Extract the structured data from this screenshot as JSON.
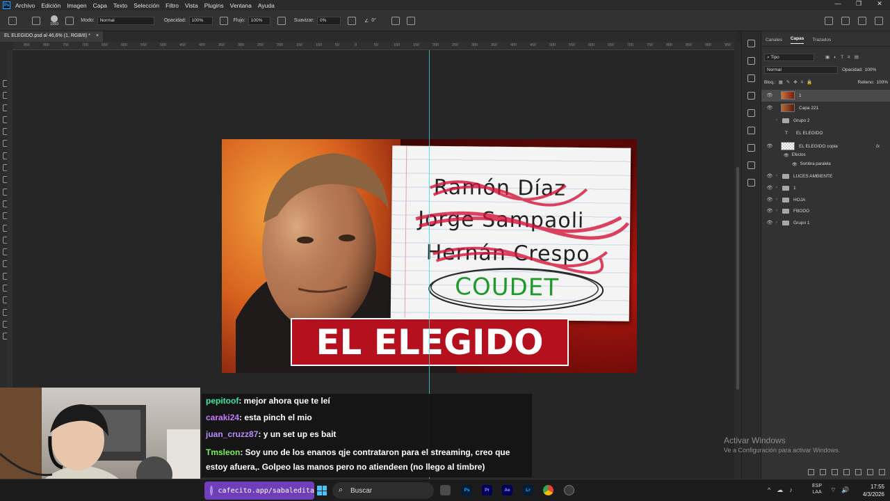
{
  "menubar": {
    "items": [
      "Archivo",
      "Edición",
      "Imagen",
      "Capa",
      "Texto",
      "Selección",
      "Filtro",
      "Vista",
      "Plugins",
      "Ventana",
      "Ayuda"
    ],
    "app_icon": "Ps"
  },
  "options": {
    "brush_size": "1993",
    "mode_label": "Modo:",
    "mode_value": "Normal",
    "opacity_label": "Opacidad:",
    "opacity_value": "100%",
    "flow_label": "Flujo:",
    "flow_value": "100%",
    "smoothing_label": "Suavizar:",
    "smoothing_value": "0%",
    "angle_value": "0°"
  },
  "document": {
    "tab_title": "EL ELEGIDO.psd al 46,6% (1, RGB/8) *"
  },
  "ruler": {
    "ticks": [
      "900",
      "850",
      "800",
      "750",
      "700",
      "650",
      "600",
      "550",
      "500",
      "450",
      "400",
      "350",
      "300",
      "250",
      "200",
      "150",
      "100",
      "50",
      "0",
      "50",
      "100",
      "150",
      "200",
      "250",
      "300",
      "350",
      "400",
      "450",
      "500",
      "550",
      "600",
      "650",
      "700",
      "750",
      "800",
      "850",
      "900",
      "950",
      "1000",
      "1050",
      "1100",
      "1150",
      "1200",
      "1250",
      "1300",
      "1350",
      "1400",
      "1450",
      "1500",
      "1550",
      "1600",
      "1650",
      "1700",
      "1750",
      "1800",
      "1850",
      "1900",
      "1950",
      "2000",
      "2050",
      "2100",
      "2150",
      "2200",
      "2250",
      "2300"
    ]
  },
  "thumbnail": {
    "names": [
      "Ramón Díaz",
      "Jorge Sampaoli",
      "Hernán Crespo"
    ],
    "circled_name": "COUDET",
    "title": "EL ELEGIDO"
  },
  "panel": {
    "tabs": [
      "Canales",
      "Capas",
      "Trazados"
    ],
    "filter_label": "Tipo",
    "blend_mode": "Normal",
    "opacity_label": "Opacidad:",
    "opacity_value": "100%",
    "lock_label": "Bloq.:",
    "fill_label": "Relleno:",
    "fill_value": "100%",
    "layers": [
      {
        "name": "1",
        "kind": "image",
        "visible": true,
        "selected": true
      },
      {
        "name": "Capa 221",
        "kind": "image",
        "visible": true
      },
      {
        "name": "Grupo 2",
        "kind": "group",
        "visible": false
      },
      {
        "name": "EL ELEGIDO",
        "kind": "text",
        "visible": false
      },
      {
        "name": "EL ELEGIDO copia",
        "kind": "image",
        "visible": true,
        "fx": "fx"
      },
      {
        "name": "Efectos",
        "kind": "effects",
        "visible": true
      },
      {
        "name": "Sombra paralela",
        "kind": "effect",
        "visible": true
      },
      {
        "name": "LUCES AMBIENTE",
        "kind": "group",
        "visible": true
      },
      {
        "name": "1",
        "kind": "group",
        "visible": true
      },
      {
        "name": "HOJA",
        "kind": "group",
        "visible": true
      },
      {
        "name": "FBODO",
        "kind": "group",
        "visible": true
      },
      {
        "name": "Grupo 1",
        "kind": "group",
        "visible": true
      }
    ]
  },
  "watermark": {
    "line1": "Activar Windows",
    "line2": "Ve a Configuración para activar Windows."
  },
  "chat": [
    {
      "user": "pepitoof",
      "text": ": mejor ahora que te leí",
      "color": "#3ee6a0"
    },
    {
      "user": "caraki24",
      "text": ": esta pinch el mio",
      "color": "#c77dff"
    },
    {
      "user": "juan_cruzz87",
      "text": ": y un set up es bait",
      "color": "#b48cff"
    },
    {
      "user": "Tmsleon",
      "text": ": Soy uno de los enanos qje contrataron para el streaming, creo que estoy afuera,. Golpeo las manos pero no atiendeen (no llego al timbre)",
      "color": "#7cf25a"
    }
  ],
  "taskbar": {
    "cafecito": "cafecito.app/sabaledita",
    "search_placeholder": "Buscar",
    "apps": [
      "Ps",
      "Pr",
      "Ae",
      "Lr"
    ],
    "lang1": "ESP",
    "lang2": "LAA",
    "time": "17:55",
    "date": "4/3/2026"
  },
  "colors": {
    "banner_red": "#b5101e",
    "guide": "#3fd9d0",
    "coudet_green": "#1f9a2c",
    "scribble_red": "#d4143a"
  }
}
